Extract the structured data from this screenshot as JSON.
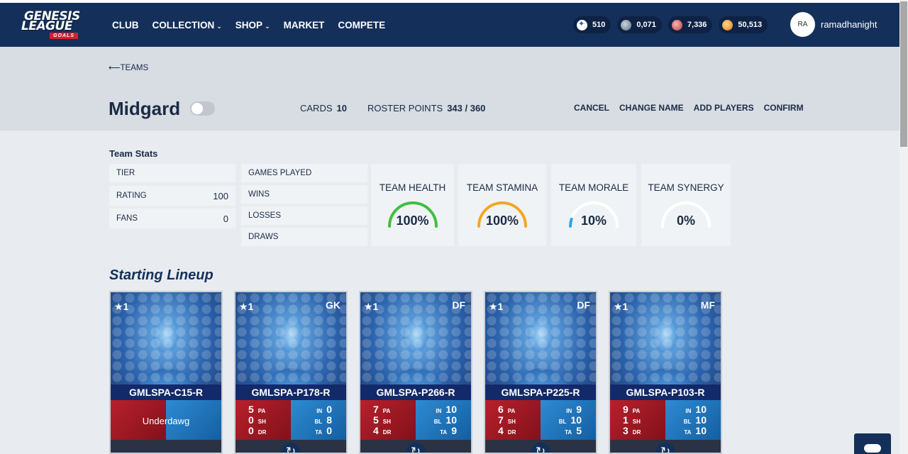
{
  "brand": {
    "line1": "GENESIS",
    "line2": "LEAGUE",
    "line3": "GOALS"
  },
  "nav": [
    {
      "label": "CLUB",
      "dropdown": false
    },
    {
      "label": "COLLECTION",
      "dropdown": true
    },
    {
      "label": "SHOP",
      "dropdown": true
    },
    {
      "label": "MARKET",
      "dropdown": false
    },
    {
      "label": "COMPETE",
      "dropdown": false
    }
  ],
  "currencies": [
    {
      "icon": "star-token-icon",
      "value": "510"
    },
    {
      "icon": "ball-token-icon",
      "value": "0,071"
    },
    {
      "icon": "red-token-icon",
      "value": "7,336"
    },
    {
      "icon": "gold-token-icon",
      "value": "50,513"
    }
  ],
  "user": {
    "initials": "RA",
    "name": "ramadhanight"
  },
  "back_label": "TEAMS",
  "team": {
    "name": "Midgard",
    "cards_label": "CARDS",
    "cards_value": "10",
    "roster_label": "ROSTER POINTS",
    "roster_value": "343 / 360"
  },
  "actions": [
    "CANCEL",
    "CHANGE NAME",
    "ADD PLAYERS",
    "CONFIRM"
  ],
  "team_stats": {
    "title": "Team Stats",
    "left": [
      {
        "label": "TIER",
        "value": ""
      },
      {
        "label": "RATING",
        "value": "100"
      },
      {
        "label": "FANS",
        "value": "0"
      }
    ],
    "middle": [
      {
        "label": "GAMES PLAYED"
      },
      {
        "label": "WINS"
      },
      {
        "label": "LOSSES"
      },
      {
        "label": "DRAWS"
      }
    ],
    "gauges": [
      {
        "label": "TEAM HEALTH",
        "value": "100%",
        "fraction": 1.0,
        "color": "#3fbf3f"
      },
      {
        "label": "TEAM STAMINA",
        "value": "100%",
        "fraction": 1.0,
        "color": "#f5a623"
      },
      {
        "label": "TEAM MORALE",
        "value": "10%",
        "fraction": 0.1,
        "color": "#29a8e8"
      },
      {
        "label": "TEAM SYNERGY",
        "value": "0%",
        "fraction": 0.0,
        "color": "#29a8e8"
      }
    ]
  },
  "lineup": {
    "title": "Starting Lineup",
    "cards": [
      {
        "stars": "★1",
        "position": "",
        "name": "GMLSPA-C15-R",
        "special": "Underdawg"
      },
      {
        "stars": "★1",
        "position": "GK",
        "name": "GMLSPA-P178-R",
        "stats": {
          "PA": "5",
          "SH": "0",
          "DR": "0",
          "IN": "0",
          "BL": "8",
          "TA": "0"
        }
      },
      {
        "stars": "★1",
        "position": "DF",
        "name": "GMLSPA-P266-R",
        "stats": {
          "PA": "7",
          "SH": "5",
          "DR": "4",
          "IN": "10",
          "BL": "10",
          "TA": "9"
        }
      },
      {
        "stars": "★1",
        "position": "DF",
        "name": "GMLSPA-P225-R",
        "stats": {
          "PA": "6",
          "SH": "7",
          "DR": "4",
          "IN": "9",
          "BL": "10",
          "TA": "5"
        }
      },
      {
        "stars": "★1",
        "position": "MF",
        "name": "GMLSPA-P103-R",
        "stats": {
          "PA": "9",
          "SH": "1",
          "DR": "3",
          "IN": "10",
          "BL": "10",
          "TA": "10"
        }
      }
    ]
  }
}
